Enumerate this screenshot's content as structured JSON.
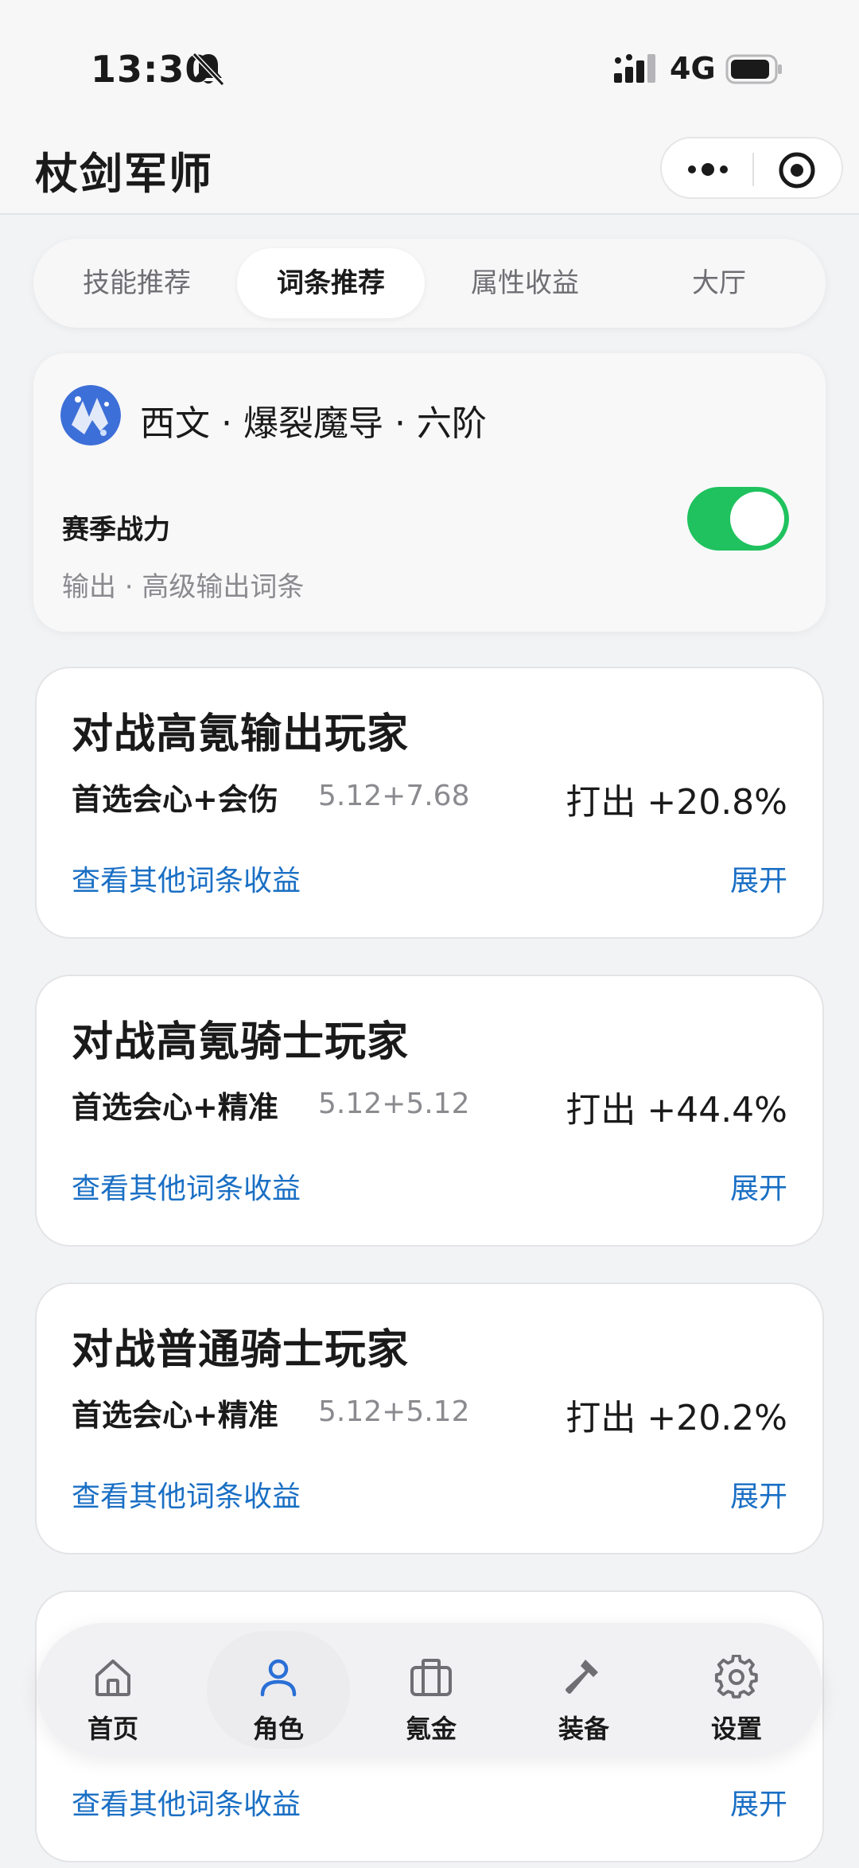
{
  "status": {
    "time": "13:30",
    "network": "4G"
  },
  "header": {
    "title": "杖剑军师"
  },
  "tabs": [
    {
      "label": "技能推荐"
    },
    {
      "label": "词条推荐"
    },
    {
      "label": "属性收益"
    },
    {
      "label": "大厅"
    }
  ],
  "profile": {
    "name": "西文 · 爆裂魔导 · 六阶",
    "season_label": "赛季战力",
    "season_sub": "输出 · 高级输出词条",
    "toggle_on": true
  },
  "cards": [
    {
      "title": "对战高氪输出玩家",
      "pick": "首选会心+会伤",
      "value": "5.12+7.68",
      "result": "打出 +20.8%",
      "link": "查看其他词条收益",
      "expand": "展开"
    },
    {
      "title": "对战高氪骑士玩家",
      "pick": "首选会心+精准",
      "value": "5.12+5.12",
      "result": "打出 +44.4%",
      "link": "查看其他词条收益",
      "expand": "展开"
    },
    {
      "title": "对战普通骑士玩家",
      "pick": "首选会心+精准",
      "value": "5.12+5.12",
      "result": "打出 +20.2%",
      "link": "查看其他词条收益",
      "expand": "展开"
    },
    {
      "link": "查看其他词条收益",
      "expand": "展开"
    }
  ],
  "nav": [
    {
      "label": "首页",
      "icon": "home-icon"
    },
    {
      "label": "角色",
      "icon": "user-icon"
    },
    {
      "label": "氪金",
      "icon": "briefcase-icon"
    },
    {
      "label": "装备",
      "icon": "hammer-icon"
    },
    {
      "label": "设置",
      "icon": "gear-icon"
    }
  ],
  "colors": {
    "accent": "#1a6fc4",
    "toggle": "#1fc25e",
    "nav_active": "#2a6fd6"
  }
}
